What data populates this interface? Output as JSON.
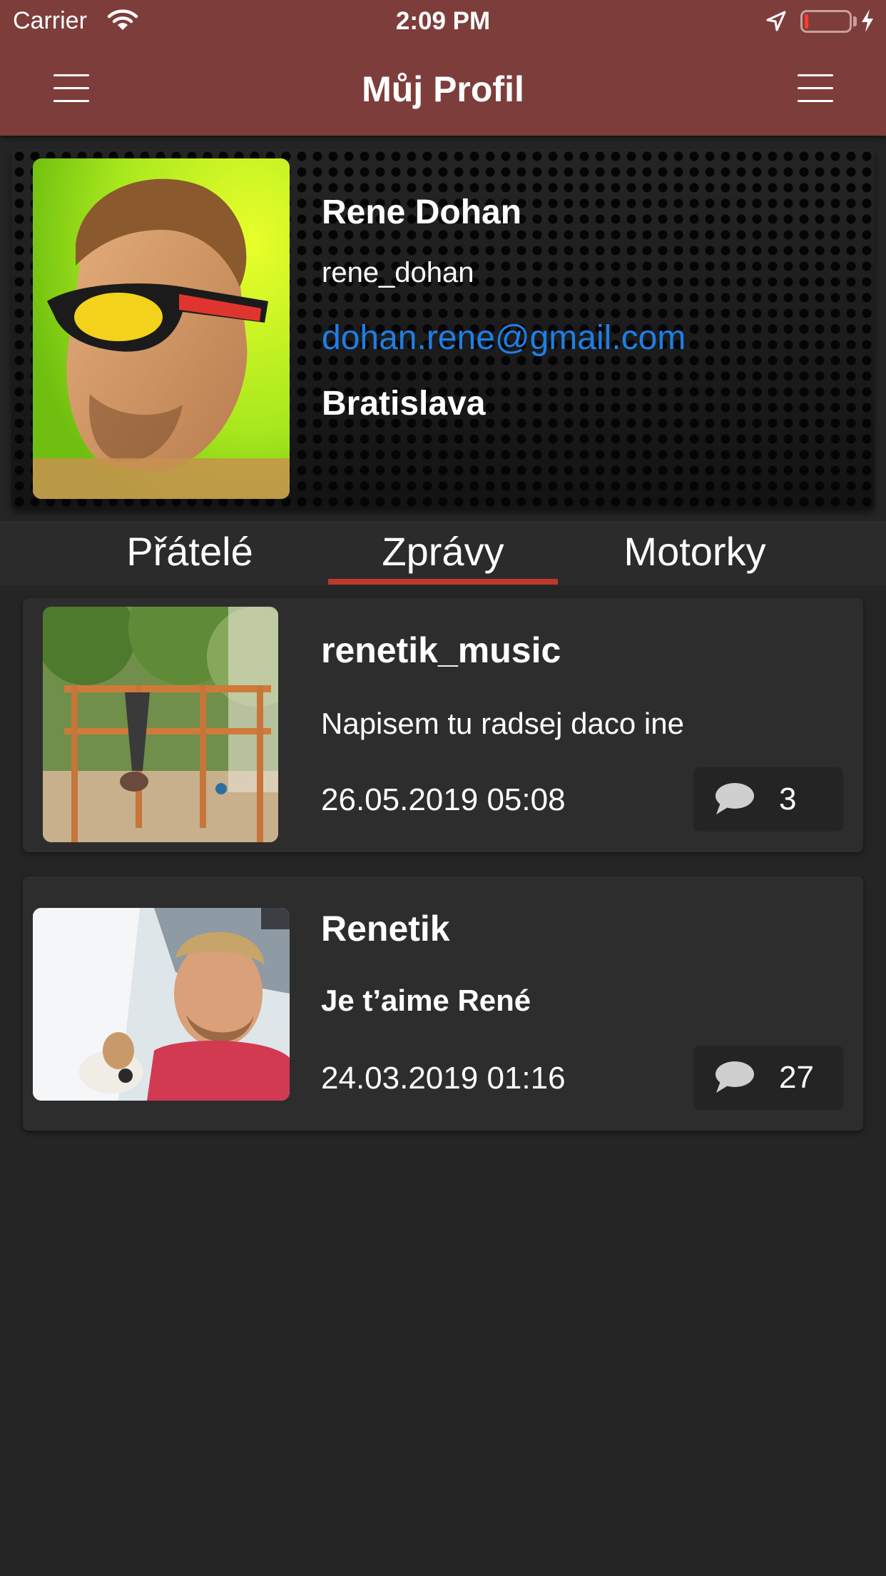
{
  "status_bar": {
    "carrier": "Carrier",
    "time": "2:09 PM",
    "battery_level": 0.08,
    "battery_color": "#ff3b30"
  },
  "nav": {
    "title": "Můj Profil",
    "left_icon": "hamburger-menu-icon",
    "right_icon": "hamburger-menu-icon",
    "bar_color": "#7d3e3b"
  },
  "profile": {
    "name": "Rene Dohan",
    "username": "rene_dohan",
    "email": "dohan.rene@gmail.com",
    "city": "Bratislava",
    "email_color": "#1e7fe6"
  },
  "tabs": {
    "items": [
      {
        "label": "Přátelé"
      },
      {
        "label": "Zprávy"
      },
      {
        "label": "Motorky"
      }
    ],
    "selected": "Zprávy",
    "accent": "#c0382b"
  },
  "messages": [
    {
      "user": "renetik_music",
      "text": "Napisem tu radsej daco ine",
      "date": "26.05.2019 05:08",
      "comments": "3",
      "comment_icon": "speech-bubble-icon"
    },
    {
      "user": "Renetik",
      "text": "Je t’aime René",
      "date": "24.03.2019 01:16",
      "comments": "27",
      "comment_icon": "speech-bubble-icon"
    }
  ]
}
